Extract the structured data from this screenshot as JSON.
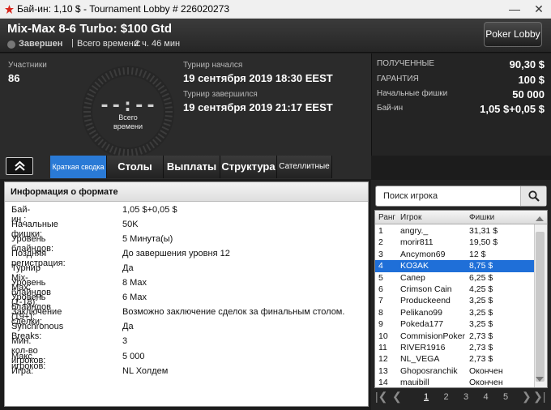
{
  "window": {
    "title": "Бай-ин: 1,10 $ - Tournament Lobby # 226020273",
    "controls": [
      "minimize",
      "close"
    ]
  },
  "header": {
    "tournament_name": "Mix-Max 8-6 Turbo: $100 Gtd",
    "status": "Завершен",
    "separator": "|",
    "total_time_label": "Всего времени:",
    "total_time_value": "2 ч. 46 мин",
    "poker_lobby_button": "Poker Lobby"
  },
  "summary": {
    "participants_label": "Участники",
    "participants_value": "86",
    "clock_digits": "--:--",
    "clock_caption_1": "Всего",
    "clock_caption_2": "времени",
    "started_label": "Турнир начался",
    "started_value": "19 сентября 2019   18:30 EEST",
    "finished_label": "Турнир завершился",
    "finished_value": "19 сентября 2019   21:17 EEST"
  },
  "stats": [
    {
      "label": "ПОЛУЧЕННЫЕ",
      "value": "90,30 $"
    },
    {
      "label": "ГАРАНТИЯ",
      "value": "100 $"
    },
    {
      "label": "Начальные фишки",
      "value": "50 000"
    },
    {
      "label": "Бай-ин",
      "value": "1,05 $+0,05 $"
    }
  ],
  "tabs": [
    {
      "label": "Краткая сводка",
      "active": true
    },
    {
      "label": "Столы",
      "active": false
    },
    {
      "label": "Выплаты",
      "active": false
    },
    {
      "label": "Структура",
      "active": false
    },
    {
      "label": "Сателлитные",
      "active": false
    }
  ],
  "format_info": {
    "heading": "Информация о формате",
    "rows": [
      {
        "key": "Бай-ин :",
        "value": "1,05 $+0,05 $"
      },
      {
        "key": "Начальные фишки:",
        "value": "50K"
      },
      {
        "key": "Уровень блайндов:",
        "value": "5 Минута(ы)"
      },
      {
        "key": "Поздняя регистрация:",
        "value": "До завершения уровня 12"
      },
      {
        "key": "Турнир Mix-Max:",
        "value": "Да"
      },
      {
        "key": "Уровень блайндов (1-18):",
        "value": "8 Max"
      },
      {
        "key": "Уровень блайндов (19+):",
        "value": "6 Max"
      },
      {
        "key": "Заключение сделки:",
        "value": "Возможно заключение сделок за финальным столом."
      },
      {
        "key": "Synchronous Breaks:",
        "value": "Да"
      },
      {
        "key": "Мин. кол-во игроков:",
        "value": "3"
      },
      {
        "key": "Макс. игроков:",
        "value": "5 000"
      },
      {
        "key": "Игра:",
        "value": "NL Холдем"
      }
    ]
  },
  "players": {
    "search_placeholder": "Поиск игрока",
    "columns": [
      "Ранг",
      "Игрок",
      "Фишки"
    ],
    "selected_rank": "4",
    "rows": [
      {
        "rank": "1",
        "name": "angry._",
        "chips": "31,31 $"
      },
      {
        "rank": "2",
        "name": "morir811",
        "chips": "19,50 $"
      },
      {
        "rank": "3",
        "name": "Ancymon69",
        "chips": "12 $"
      },
      {
        "rank": "4",
        "name": "KO3AK",
        "chips": "8,75 $"
      },
      {
        "rank": "5",
        "name": "Caпер",
        "chips": "6,25 $"
      },
      {
        "rank": "6",
        "name": "Crimson Cain",
        "chips": "4,25 $"
      },
      {
        "rank": "7",
        "name": "Produckeend",
        "chips": "3,25 $"
      },
      {
        "rank": "8",
        "name": "Pelikano99",
        "chips": "3,25 $"
      },
      {
        "rank": "9",
        "name": "Pokeda177",
        "chips": "3,25 $"
      },
      {
        "rank": "10",
        "name": "CommisionPoker",
        "chips": "2,73 $"
      },
      {
        "rank": "11",
        "name": "RIVER1916",
        "chips": "2,73 $"
      },
      {
        "rank": "12",
        "name": "NL_VEGA",
        "chips": "2,73 $"
      },
      {
        "rank": "13",
        "name": "Ghoposranchik",
        "chips": "Окончен"
      },
      {
        "rank": "14",
        "name": "mauibill",
        "chips": "Окончен"
      }
    ],
    "pages": [
      "1",
      "2",
      "3",
      "4",
      "5"
    ],
    "current_page": "1"
  },
  "colors": {
    "accent": "#2a7ad6",
    "selected_row": "#1f6fd8",
    "background": "#1c1c1c",
    "logo": "#d8261c"
  }
}
